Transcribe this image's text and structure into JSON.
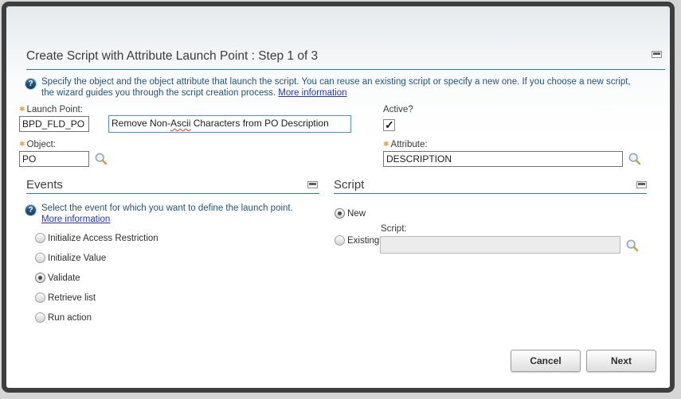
{
  "dialog": {
    "title": "Create Script with Attribute Launch Point : Step 1 of 3",
    "intro": {
      "text": "Specify the object and the object attribute that launch the script. You can reuse an existing script or specify a new one. If you choose a new script, the wizard guides you through the script creation process.",
      "link": "More information"
    },
    "fields": {
      "launch_point": {
        "label": "Launch Point:",
        "value": "BPD_FLD_PO"
      },
      "description": {
        "value_before": "Remove Non-",
        "value_misspelled": "Ascii",
        "value_after": " Characters from PO Description"
      },
      "active": {
        "label": "Active?",
        "checked": true
      },
      "object": {
        "label": "Object:",
        "value": "PO"
      },
      "attribute": {
        "label": "Attribute:",
        "value": "DESCRIPTION"
      }
    },
    "events": {
      "header": "Events",
      "intro_text": "Select the event for which you want to define the launch point.",
      "intro_link": "More information",
      "options": [
        {
          "label": "Initialize Access Restriction",
          "selected": false
        },
        {
          "label": "Initialize Value",
          "selected": false
        },
        {
          "label": "Validate",
          "selected": true
        },
        {
          "label": "Retrieve list",
          "selected": false
        },
        {
          "label": "Run action",
          "selected": false
        }
      ]
    },
    "script": {
      "header": "Script",
      "new_label": "New",
      "new_selected": true,
      "existing_label": "Existing:",
      "existing_selected": false,
      "script_field_label": "Script:",
      "script_field_value": ""
    },
    "buttons": {
      "cancel": "Cancel",
      "next": "Next"
    },
    "colors": {
      "accent_rule": "#2e7d9e",
      "link": "#2135cc",
      "required_asterisk": "#eda33c"
    }
  }
}
